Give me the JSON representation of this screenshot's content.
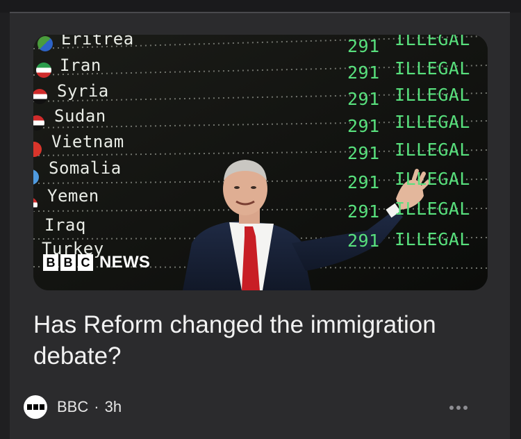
{
  "story": {
    "headline": "Has Reform changed the immigration debate?",
    "source": "BBC",
    "separator": "·",
    "age": "3h"
  },
  "image": {
    "board_rows": [
      {
        "country": "Eritrea",
        "number": "291",
        "status": "ILLEGAL",
        "flag": "eritrea-flag"
      },
      {
        "country": "Iran",
        "number": "291",
        "status": "ILLEGAL",
        "flag": "iran-flag"
      },
      {
        "country": "Syria",
        "number": "291",
        "status": "ILLEGAL",
        "flag": "syria-flag"
      },
      {
        "country": "Sudan",
        "number": "291",
        "status": "ILLEGAL",
        "flag": "sudan-flag"
      },
      {
        "country": "Vietnam",
        "number": "291",
        "status": "ILLEGAL",
        "flag": "vietnam-flag"
      },
      {
        "country": "Somalia",
        "number": "291",
        "status": "ILLEGAL",
        "flag": "somalia-flag"
      },
      {
        "country": "Yemen",
        "number": "291",
        "status": "ILLEGAL",
        "flag": "yemen-flag"
      },
      {
        "country": "Iraq",
        "number": "291",
        "status": "ILLEGAL",
        "flag": "iraq-flag"
      },
      {
        "country": "Turkey",
        "number": "",
        "status": "ILLEGAL",
        "flag": "turkey-flag"
      }
    ],
    "logo": {
      "letters": [
        "B",
        "B",
        "C"
      ],
      "word": "NEWS"
    }
  },
  "icons": {
    "source_avatar": "bbc-logo-icon",
    "more": "ellipsis-icon"
  },
  "colors": {
    "background": "#2b2b2d",
    "headline": "#f2f2f2",
    "board_text": "#e9ece6",
    "board_status": "#58e07d",
    "muted": "#8e8e93"
  }
}
